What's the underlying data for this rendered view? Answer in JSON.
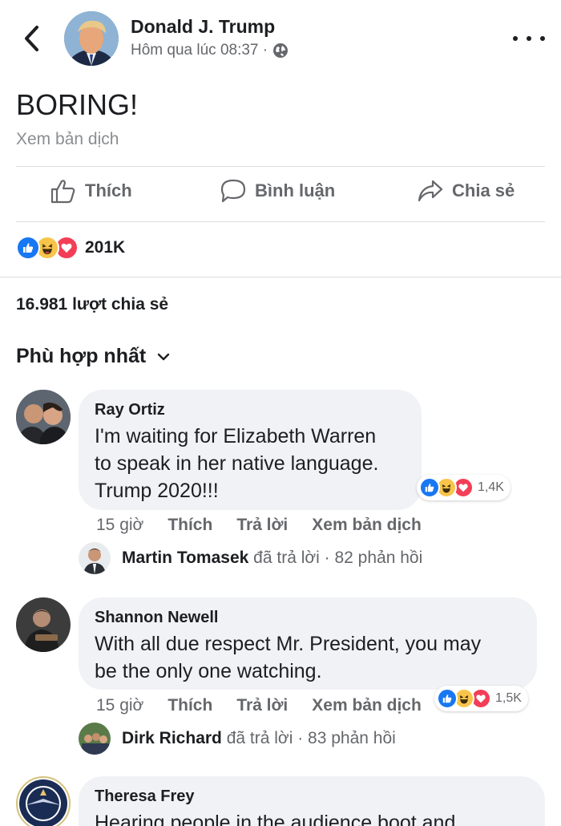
{
  "header": {
    "author": "Donald J. Trump",
    "timestamp": "Hôm qua lúc 08:37 ·",
    "back_icon": "chevron-left-icon",
    "privacy_icon": "globe-icon",
    "more_icon": "more-dots-icon"
  },
  "post": {
    "text": "BORING!",
    "see_translation": "Xem bản dịch"
  },
  "actions": {
    "like": "Thích",
    "comment": "Bình luận",
    "share": "Chia sẻ"
  },
  "reactions": {
    "count": "201K",
    "types": [
      "like",
      "haha",
      "love"
    ]
  },
  "shares": "16.981 lượt chia sẻ",
  "sort_label": "Phù hợp nhất",
  "comments": [
    {
      "name": "Ray Ortiz",
      "text_lines": [
        "I'm waiting for Elizabeth Warren",
        "to speak in her native language.",
        "Trump 2020!!!"
      ],
      "reaction_count": "1,4K",
      "time": "15 giờ",
      "like": "Thích",
      "reply": "Trả lời",
      "translate": "Xem bản dịch",
      "reply_author": "Martin Tomasek",
      "reply_suffix": "đã trả lời · 82 phản hồi"
    },
    {
      "name": "Shannon Newell",
      "text_lines": [
        "With all due respect Mr. President, you may",
        "be the only one watching."
      ],
      "reaction_count": "1,5K",
      "time": "15 giờ",
      "like": "Thích",
      "reply": "Trả lời",
      "translate": "Xem bản dịch",
      "reply_author": "Dirk Richard",
      "reply_suffix": "đã trả lời · 83 phản hồi"
    },
    {
      "name": "Theresa Frey",
      "text_lines": [
        "Hearing people in the audience boot and"
      ]
    }
  ],
  "colors": {
    "like_blue": "#1877f2",
    "love_red": "#f33e58",
    "haha_yellow": "#f7c54a",
    "secondary_text": "#65676b",
    "bubble_bg": "#f0f2f5"
  }
}
